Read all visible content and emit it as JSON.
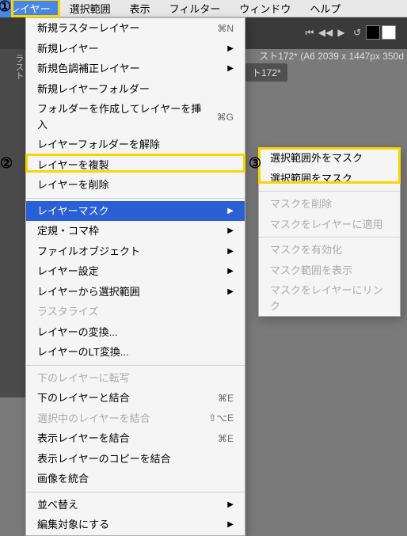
{
  "menubar": {
    "items": [
      "レイヤー",
      "選択範囲",
      "表示",
      "フィルター",
      "ウィンドウ",
      "ヘルプ"
    ],
    "active_index": 0
  },
  "annotations": {
    "one": "①",
    "two": "②",
    "three": "③"
  },
  "document": {
    "title_fragment": "スト172* (A6 2039 x 1447px 350d",
    "tab_label": "ト172*",
    "side_label": "ラスト"
  },
  "toolbar_icons": {
    "rewind": "rewind-icon",
    "skip_prev": "skip-prev-icon",
    "play": "play-icon",
    "swap": "swap-icon"
  },
  "menu": {
    "new_raster": "新規ラスターレイヤー",
    "new_raster_sc": "⌘N",
    "new_layer": "新規レイヤー",
    "new_correction": "新規色調補正レイヤー",
    "new_folder": "新規レイヤーフォルダー",
    "folder_insert": "フォルダーを作成してレイヤーを挿入",
    "folder_insert_sc": "⌘G",
    "unfolder": "レイヤーフォルダーを解除",
    "duplicate": "レイヤーを複製",
    "delete": "レイヤーを削除",
    "layer_mask": "レイヤーマスク",
    "ruler": "定規・コマ枠",
    "file_object": "ファイルオブジェクト",
    "layer_settings": "レイヤー設定",
    "sel_from_layer": "レイヤーから選択範囲",
    "rasterize": "ラスタライズ",
    "convert": "レイヤーの変換...",
    "lt_convert": "レイヤーのLT変換...",
    "transfer_down": "下のレイヤーに転写",
    "merge_down": "下のレイヤーと結合",
    "merge_down_sc": "⌘E",
    "merge_selected": "選択中のレイヤーを結合",
    "merge_selected_sc": "⇧⌥E",
    "merge_visible": "表示レイヤーを結合",
    "merge_visible_sc": "⌘E",
    "merge_visible_copy": "表示レイヤーのコピーを結合",
    "flatten": "画像を統合",
    "reorder": "並べ替え",
    "edit_target": "編集対象にする"
  },
  "submenu": {
    "mask_outside": "選択範囲外をマスク",
    "mask_selection": "選択範囲をマスク",
    "delete_mask": "マスクを削除",
    "apply_mask": "マスクをレイヤーに適用",
    "enable_mask": "マスクを有効化",
    "show_mask_range": "マスク範囲を表示",
    "link_mask": "マスクをレイヤーにリンク"
  }
}
